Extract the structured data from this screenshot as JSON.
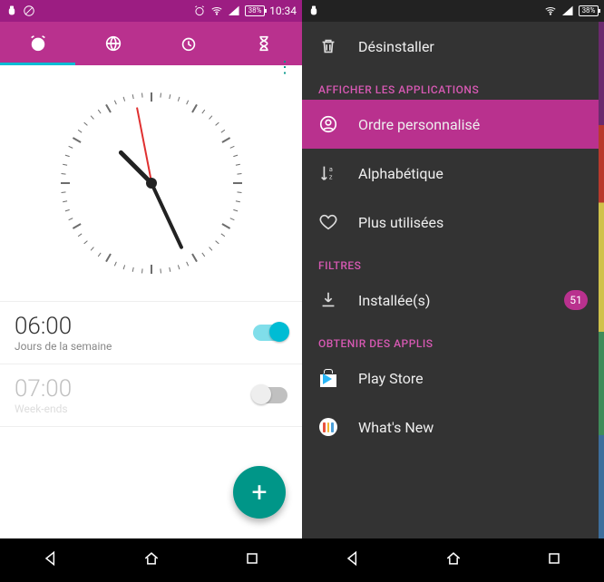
{
  "left": {
    "status": {
      "time": "10:34",
      "battery": "38%"
    },
    "clock": {
      "hourAngle": 315,
      "minAngle": 155,
      "secAngle": 349
    },
    "alarms": [
      {
        "time": "06:00",
        "sub": "Jours de la semaine",
        "on": true
      },
      {
        "time": "07:00",
        "sub": "Week-ends",
        "on": false
      }
    ],
    "fab": "+"
  },
  "right": {
    "status": {
      "battery": "38%"
    },
    "uninstall": "Désinstaller",
    "sections": {
      "view": "AFFICHER LES APPLICATIONS",
      "filters": "FILTRES",
      "get": "OBTENIR DES APPLIS"
    },
    "view": {
      "custom": "Ordre personnalisé",
      "alpha": "Alphabétique",
      "most": "Plus utilisées"
    },
    "filters": {
      "installed": "Installée(s)",
      "badge": "51"
    },
    "get": {
      "play": "Play Store",
      "wnew": "What's New"
    }
  }
}
